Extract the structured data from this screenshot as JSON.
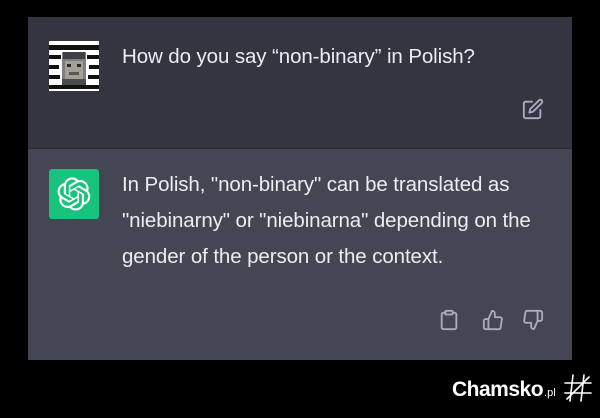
{
  "conversation": {
    "user_message": {
      "avatar": "user-avatar-photo",
      "text": "How do you say “non-binary” in Polish?",
      "edit_icon": "edit-icon"
    },
    "assistant_message": {
      "avatar": "openai-logo-icon",
      "avatar_color": "#19c37d",
      "text": "In Polish, \"non-binary\" can be translated as \"niebinarny\" or \"niebinarna\" depending on the gender of the person or the context.",
      "actions": [
        "copy-icon",
        "thumbs-up-icon",
        "thumbs-down-icon"
      ]
    }
  },
  "colors": {
    "user_row_bg": "#343541",
    "assistant_row_bg": "#444654",
    "text": "#ececf1",
    "page_bg": "#000000"
  },
  "watermark": {
    "brand": "Chamsko",
    "tld": ".pl",
    "mark_icon": "hash-mark-icon"
  }
}
